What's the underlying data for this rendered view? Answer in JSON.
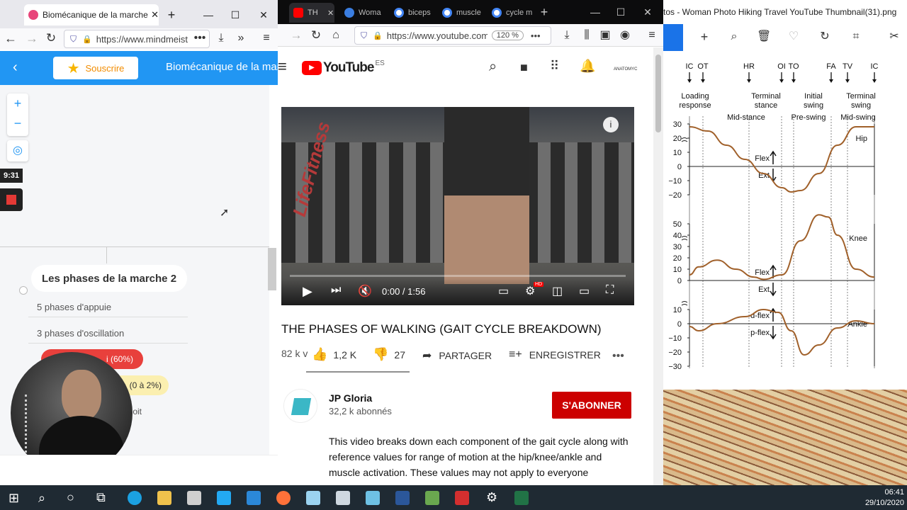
{
  "left_browser": {
    "tab_title": "Biomécanique de la marche h",
    "url": "https://www.mindmeist",
    "subscribe_label": "Souscrire",
    "page_title": "Biomécanique de la mar",
    "timer": "9:31",
    "mindmap": {
      "root": "Les phases de la marche 2",
      "items": [
        "5 phases d'appuie",
        "3 phases d'oscillation",
        "i (60%)",
        "(0 à 2%)",
        "oit"
      ]
    }
  },
  "middle_browser": {
    "tabs": [
      "TH",
      "Woma",
      "biceps",
      "muscle",
      "cycle m"
    ],
    "url": "https://www.youtube.com/",
    "zoom": "120 %",
    "youtube": {
      "logo": "YouTube",
      "region": "ES",
      "channel_badge": "ANATOMYC",
      "video_time": "0:00 / 1:56",
      "hd_badge": "HD",
      "title": "THE PHASES OF WALKING (GAIT CYCLE BREAKDOWN)",
      "views": "82 k v",
      "likes": "1,2 K",
      "dislikes": "27",
      "share_label": "PARTAGER",
      "save_label": "ENREGISTRER",
      "channel_name": "JP Gloria",
      "subscribers": "32,2 k abonnés",
      "subscribe_label": "S'ABONNER",
      "description": "This video breaks down each component of the gait cycle along with reference values for range of motion at the hip/knee/ankle and muscle activation. These values may not apply to everyone",
      "treadmill_brand": "LifeFitness"
    }
  },
  "right_viewer": {
    "title": "tos - Woman Photo Hiking Travel YouTube Thumbnail(31).png"
  },
  "chart_data": {
    "type": "line",
    "events": [
      "IC",
      "OT",
      "HR",
      "OI",
      "TO",
      "FA",
      "TV",
      "IC"
    ],
    "phase_labels_top": [
      "Loading response",
      "Terminal stance",
      "Initial swing",
      "Terminal swing"
    ],
    "phase_labels_bottom": [
      "Mid-stance",
      "Pre-swing",
      "Mid-swing"
    ],
    "panels": [
      {
        "name": "Hip",
        "ticks": [
          30,
          20,
          10,
          0,
          -10,
          -20
        ],
        "flex_label": "Flex",
        "ext_label": "Ext",
        "x": [
          0,
          10,
          20,
          30,
          40,
          50,
          55,
          60,
          70,
          80,
          90,
          100
        ],
        "values": [
          28,
          25,
          15,
          5,
          -5,
          -15,
          -18,
          -17,
          -5,
          15,
          28,
          28
        ]
      },
      {
        "name": "Knee",
        "ticks": [
          50,
          40,
          30,
          20,
          10,
          0
        ],
        "flex_label": "Flex",
        "ext_label": "Ext",
        "x": [
          0,
          5,
          15,
          25,
          35,
          40,
          50,
          60,
          70,
          75,
          80,
          90,
          100
        ],
        "values": [
          5,
          12,
          18,
          10,
          3,
          1,
          5,
          35,
          58,
          56,
          40,
          10,
          3
        ]
      },
      {
        "name": "Ankle",
        "ticks": [
          10,
          0,
          -10,
          -20,
          -30
        ],
        "flex_label": "d-flex",
        "ext_label": "p-flex",
        "x": [
          0,
          5,
          15,
          30,
          40,
          48,
          55,
          62,
          70,
          80,
          90,
          100
        ],
        "values": [
          -2,
          -5,
          0,
          5,
          10,
          8,
          -5,
          -22,
          -15,
          -3,
          2,
          0
        ]
      }
    ]
  },
  "taskbar": {
    "time": "06:41",
    "date": "29/10/2020"
  }
}
